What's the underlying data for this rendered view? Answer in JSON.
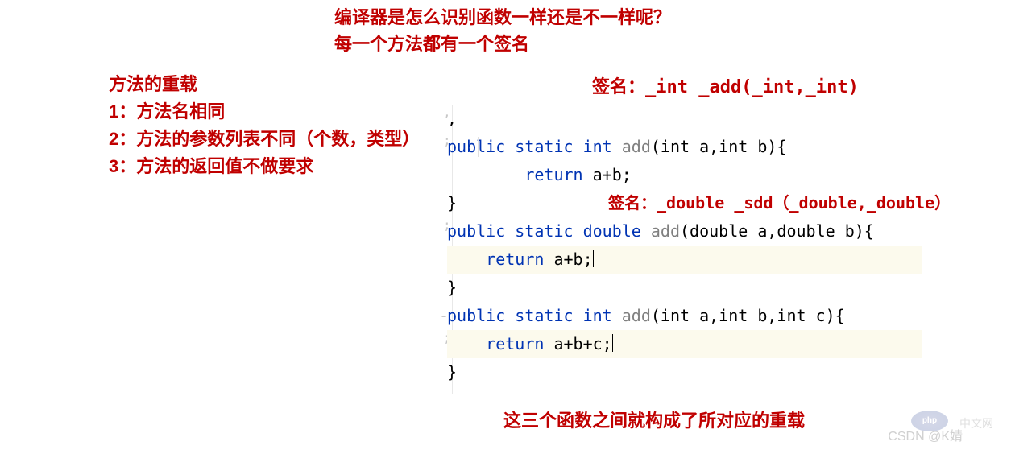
{
  "header": {
    "line1": "编译器是怎么识别函数一样还是不一样呢？",
    "line2": "每一个方法都有一个签名"
  },
  "leftNotes": {
    "title": "方法的重载",
    "rule1": "1：方法名相同",
    "rule2": "2：方法的参数列表不同（个数，类型）",
    "rule3": "3：方法的返回值不做要求"
  },
  "signature1": "签名：_int   _add(_int,_int)",
  "signature2": "签名：_double _sdd（_double,_double）",
  "code": {
    "l0": ",",
    "l1_public": "public",
    "l1_static": "static",
    "l1_int": "int",
    "l1_add": "add",
    "l1_params": "(int a,int b){",
    "l2_return": "return",
    "l2_expr": " a+b;",
    "l3": "}",
    "l4_public": "public",
    "l4_static": "static",
    "l4_double": "double",
    "l4_add": "add",
    "l4_params": "(double a,double b){",
    "l5_return": "return",
    "l5_expr": " a+b;",
    "l6": "}",
    "l7": "",
    "l8_dash": "-",
    "l8_public": "public",
    "l8_static": "static",
    "l8_int": "int",
    "l8_add": "add",
    "l8_params": "(int a,int b,int c){",
    "l9_return": "return",
    "l9_expr": " a+b+c;",
    "l10": "}"
  },
  "bottomNote": "这三个函数之间就构成了所对应的重载",
  "watermark1": "CSDN @K婧",
  "watermark2": "中文网",
  "phpBadge": "php"
}
